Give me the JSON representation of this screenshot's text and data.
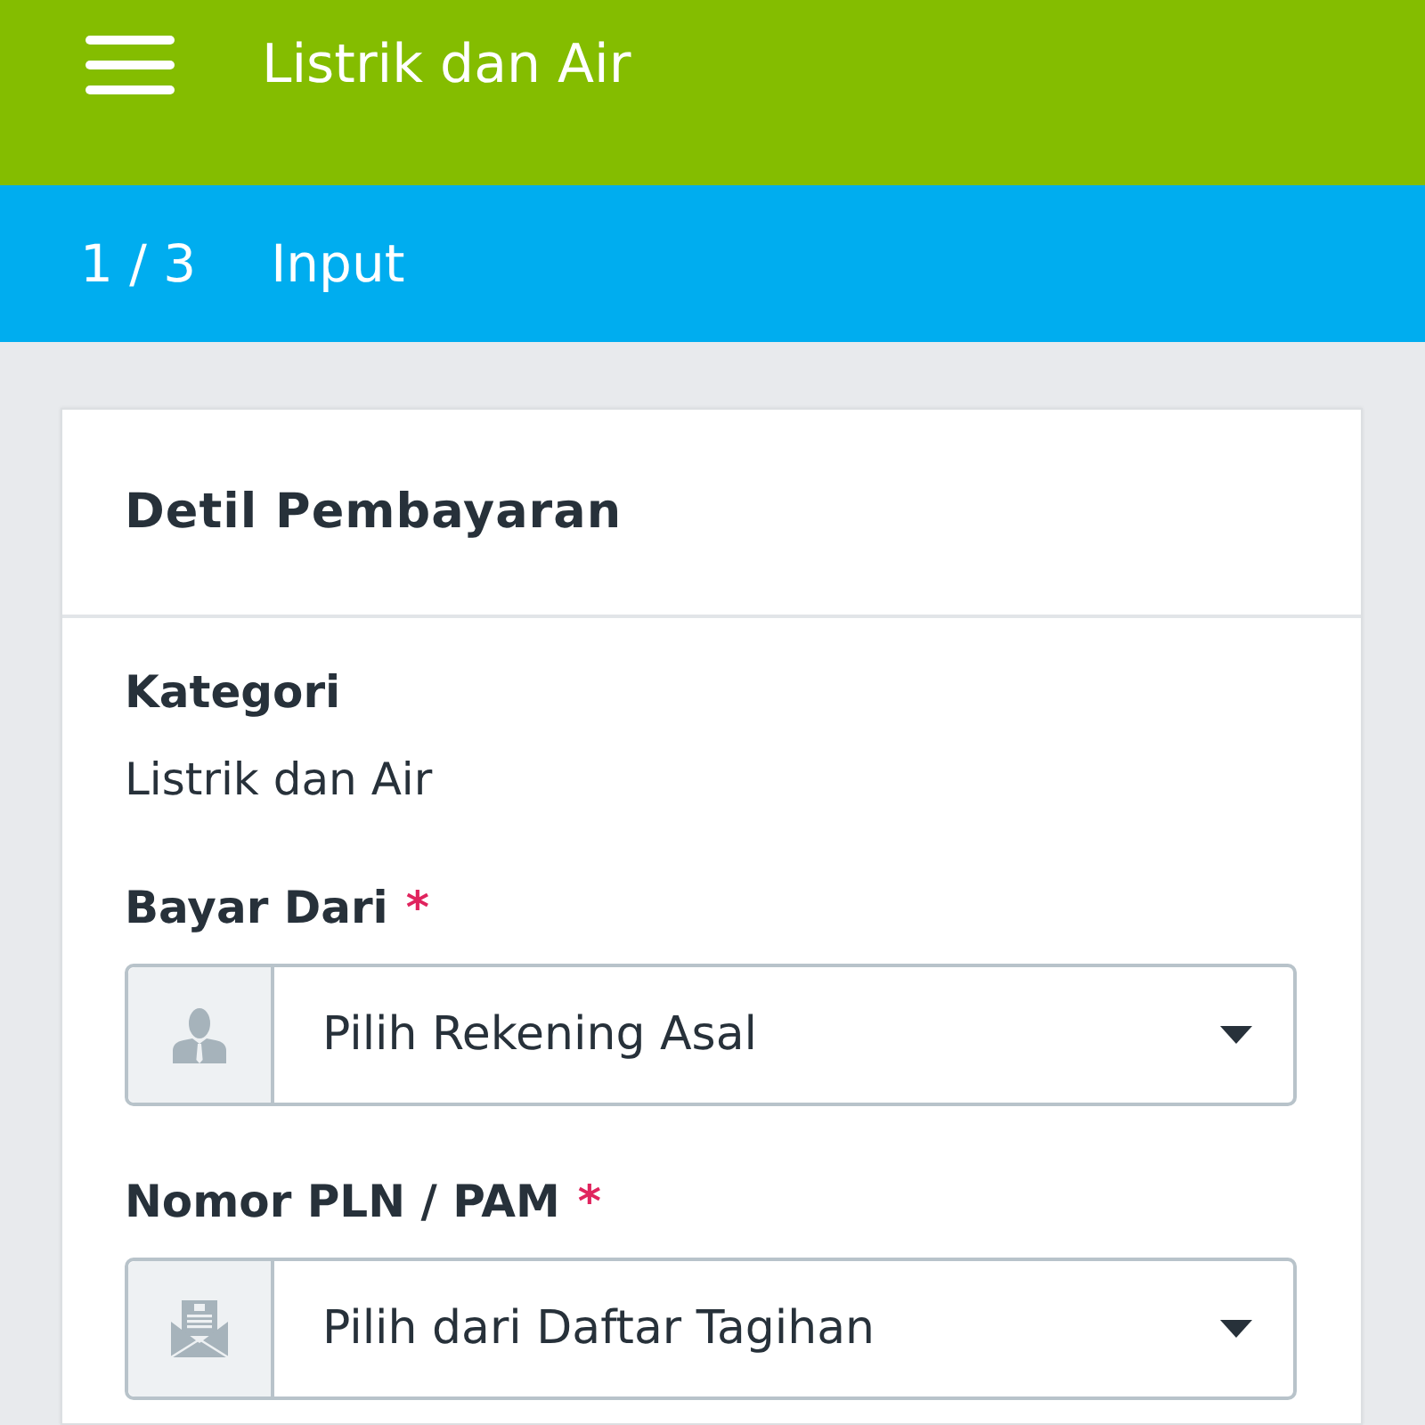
{
  "app_bar": {
    "title": "Listrik dan Air"
  },
  "step_bar": {
    "step": "1 / 3",
    "label": "Input"
  },
  "card": {
    "title": "Detil Pembayaran",
    "fields": [
      {
        "kind": "static",
        "label": "Kategori",
        "value": "Listrik dan Air"
      },
      {
        "kind": "select",
        "label": "Bayar Dari",
        "required_mark": "*",
        "placeholder": "Pilih Rekening Asal"
      },
      {
        "kind": "select",
        "label": "Nomor PLN / PAM",
        "required_mark": "*",
        "placeholder": "Pilih dari Daftar Tagihan"
      }
    ]
  }
}
